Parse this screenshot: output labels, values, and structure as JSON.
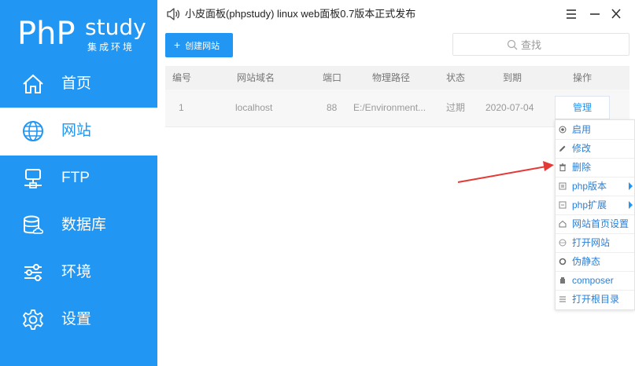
{
  "logo": {
    "php": "PhP",
    "study": "study",
    "sub": "集成环境"
  },
  "sidebar": {
    "items": [
      {
        "label": "首页",
        "icon": "home-icon"
      },
      {
        "label": "网站",
        "icon": "globe-icon",
        "active": true
      },
      {
        "label": "FTP",
        "icon": "ftp-server-icon"
      },
      {
        "label": "数据库",
        "icon": "database-icon"
      },
      {
        "label": "环境",
        "icon": "sliders-icon"
      },
      {
        "label": "设置",
        "icon": "gear-icon"
      }
    ]
  },
  "titlebar": {
    "title": "小皮面板(phpstudy) linux web面板0.7版本正式发布",
    "icon": "speaker-icon"
  },
  "toolbar": {
    "create_label": "创建网站",
    "search_placeholder": "查找"
  },
  "table": {
    "headers": [
      "编号",
      "网站域名",
      "端口",
      "物理路径",
      "状态",
      "到期",
      "操作"
    ],
    "rows": [
      {
        "id": "1",
        "domain": "localhost",
        "port": "88",
        "path": "E:/Environment...",
        "status": "过期",
        "expiry": "2020-07-04",
        "action": "管理"
      }
    ]
  },
  "dropdown": {
    "items": [
      {
        "label": "启用",
        "icon": "radio-icon"
      },
      {
        "label": "修改",
        "icon": "pencil-icon"
      },
      {
        "label": "删除",
        "icon": "trash-icon"
      },
      {
        "label": "php版本",
        "icon": "php-version-icon",
        "submenu": true
      },
      {
        "label": "php扩展",
        "icon": "php-extension-icon",
        "submenu": true
      },
      {
        "label": "网站首页设置",
        "icon": "home-small-icon"
      },
      {
        "label": "打开网站",
        "icon": "globe-small-icon"
      },
      {
        "label": "伪静态",
        "icon": "rewrite-icon"
      },
      {
        "label": "composer",
        "icon": "composer-icon"
      },
      {
        "label": "打开根目录",
        "icon": "list-icon"
      }
    ]
  },
  "colors": {
    "accent": "#2196f3",
    "annotation_arrow": "#e53935"
  }
}
